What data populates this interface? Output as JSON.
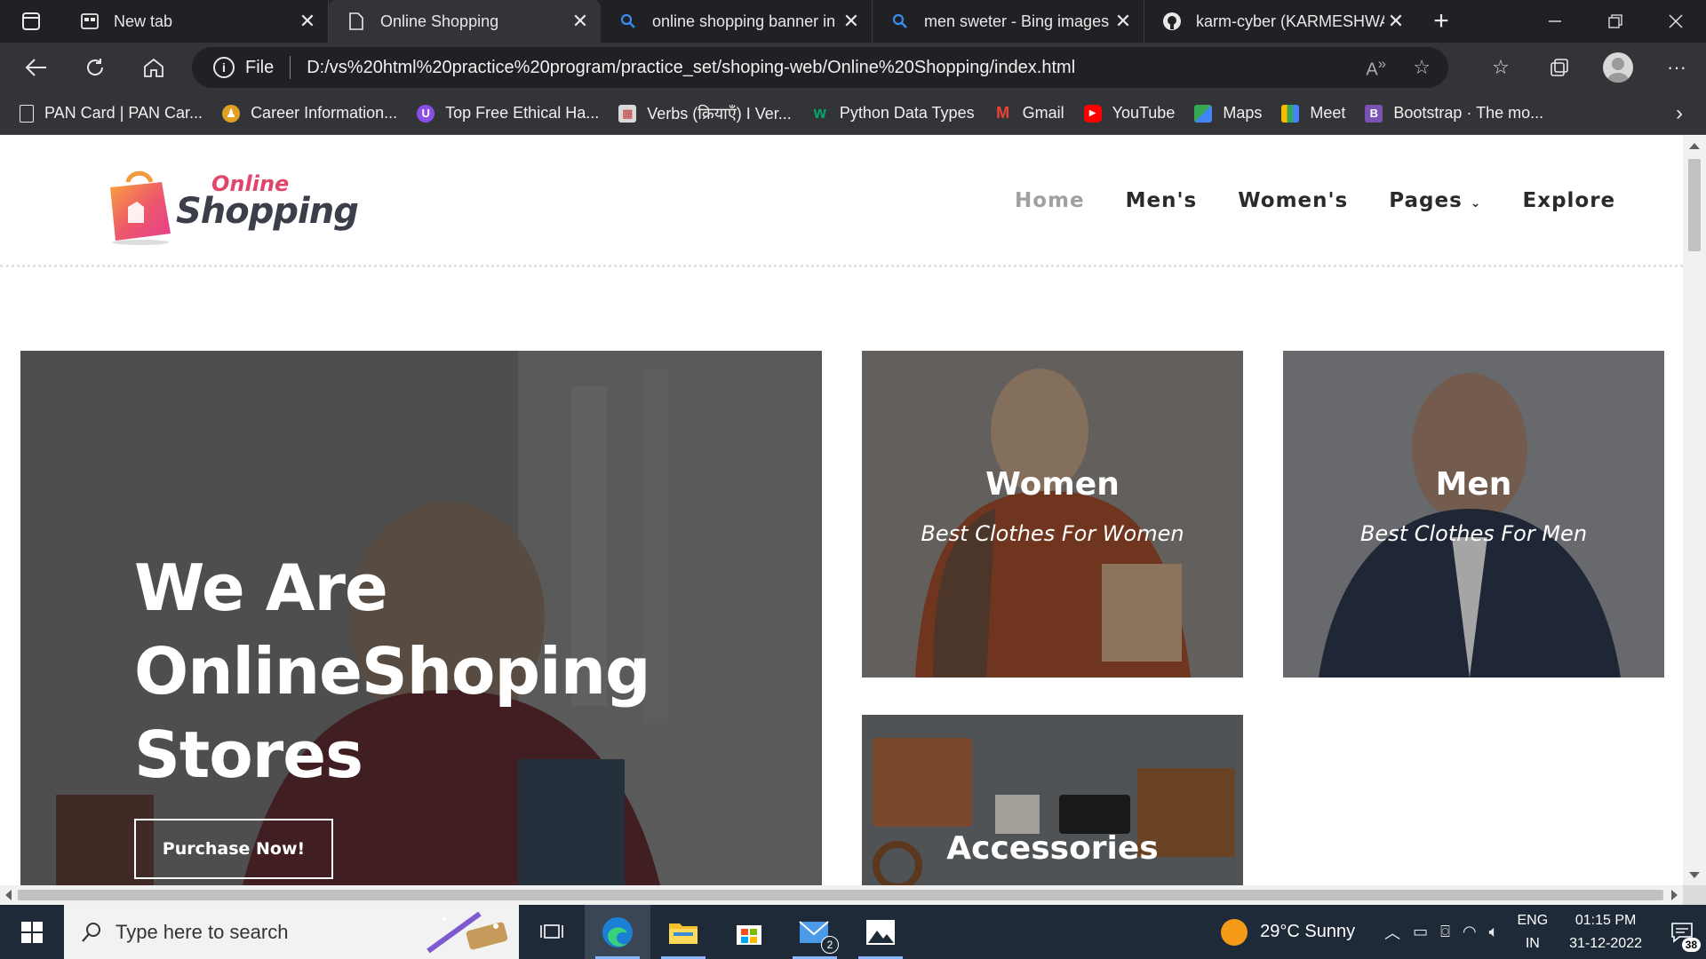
{
  "browser": {
    "tabs": [
      {
        "title": "New tab",
        "icon": "newtab-icon",
        "active": false
      },
      {
        "title": "Online Shopping",
        "icon": "page-icon",
        "active": true
      },
      {
        "title": "online shopping banner in",
        "icon": "search-icon",
        "active": false
      },
      {
        "title": "men sweter - Bing images",
        "icon": "search-icon",
        "active": false
      },
      {
        "title": "karm-cyber (KARMESHWA",
        "icon": "github-icon",
        "active": false
      }
    ],
    "address": {
      "scheme_label": "File",
      "url": "D:/vs%20html%20practice%20program/practice_set/shoping-web/Online%20Shopping/index.html"
    },
    "bookmarks": [
      {
        "label": "PAN Card | PAN Car...",
        "icon": "page-icon",
        "color": "#e8e8e8"
      },
      {
        "label": "Career Information...",
        "icon": "person-icon",
        "color": "#e0a020"
      },
      {
        "label": "Top Free Ethical Ha...",
        "icon": "shield-icon",
        "color": "#8a4fe6"
      },
      {
        "label": "Verbs (क्रियाएँ) I Ver...",
        "icon": "book-icon",
        "color": "#d23a3a"
      },
      {
        "label": "Python Data Types",
        "icon": "w3-icon",
        "color": "#04aa6d"
      },
      {
        "label": "Gmail",
        "icon": "gmail-icon",
        "color": "#ea4335"
      },
      {
        "label": "YouTube",
        "icon": "youtube-icon",
        "color": "#ff0000"
      },
      {
        "label": "Maps",
        "icon": "maps-icon",
        "color": "#34a853"
      },
      {
        "label": "Meet",
        "icon": "meet-icon",
        "color": "#00897b"
      },
      {
        "label": "Bootstrap · The mo...",
        "icon": "bootstrap-icon",
        "color": "#7952b3"
      }
    ]
  },
  "site": {
    "logo": {
      "line1": "Online",
      "line2": "Shopping"
    },
    "nav": [
      {
        "label": "Home",
        "active": true
      },
      {
        "label": "Men's",
        "active": false
      },
      {
        "label": "Women's",
        "active": false
      },
      {
        "label": "Pages",
        "active": false,
        "dropdown": true
      },
      {
        "label": "Explore",
        "active": false
      }
    ],
    "hero": {
      "line1": "We Are",
      "line2": "OnlineShoping",
      "line3": "Stores",
      "button": "Purchase Now!"
    },
    "cards": {
      "women": {
        "title": "Women",
        "subtitle": "Best Clothes For Women"
      },
      "men": {
        "title": "Men",
        "subtitle": "Best Clothes For Men"
      },
      "accessories": {
        "title": "Accessories"
      }
    },
    "colors": {
      "brand_pink": "#e2456a",
      "brand_dark": "#3b3f4a",
      "nav_active": "#a0a0a0"
    }
  },
  "taskbar": {
    "search_placeholder": "Type here to search",
    "mail_badge": "2",
    "weather": "29°C  Sunny",
    "lang1": "ENG",
    "lang2": "IN",
    "time": "01:15 PM",
    "date": "31-12-2022",
    "notifications": "38"
  }
}
